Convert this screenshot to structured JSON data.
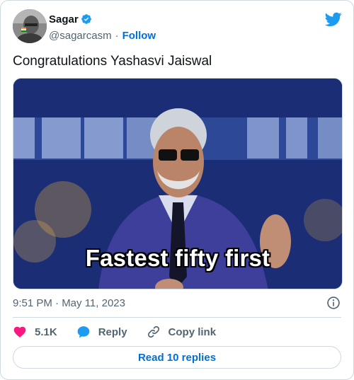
{
  "author": {
    "name": "Sagar",
    "handle": "@sagarcasm",
    "follow_label": "Follow",
    "verified_color": "#1d9bf0"
  },
  "tweet": {
    "text": "Congratulations Yashasvi Jaiswal",
    "media_caption": "Fastest fifty first",
    "timestamp": "9:51 PM · May 11, 2023"
  },
  "actions": {
    "like_count": "5.1K",
    "reply_label": "Reply",
    "copy_label": "Copy link"
  },
  "footer": {
    "replies_label": "Read 10 replies"
  },
  "icons": {
    "brand": "twitter-bird-icon",
    "like": "heart-icon",
    "reply": "reply-bubble-icon",
    "copy": "link-icon",
    "info": "info-icon"
  },
  "colors": {
    "accent": "#006fd6",
    "twitter_blue": "#1d9bf0",
    "like_red": "#f91880",
    "muted": "#536471",
    "border": "#cfd9de"
  }
}
